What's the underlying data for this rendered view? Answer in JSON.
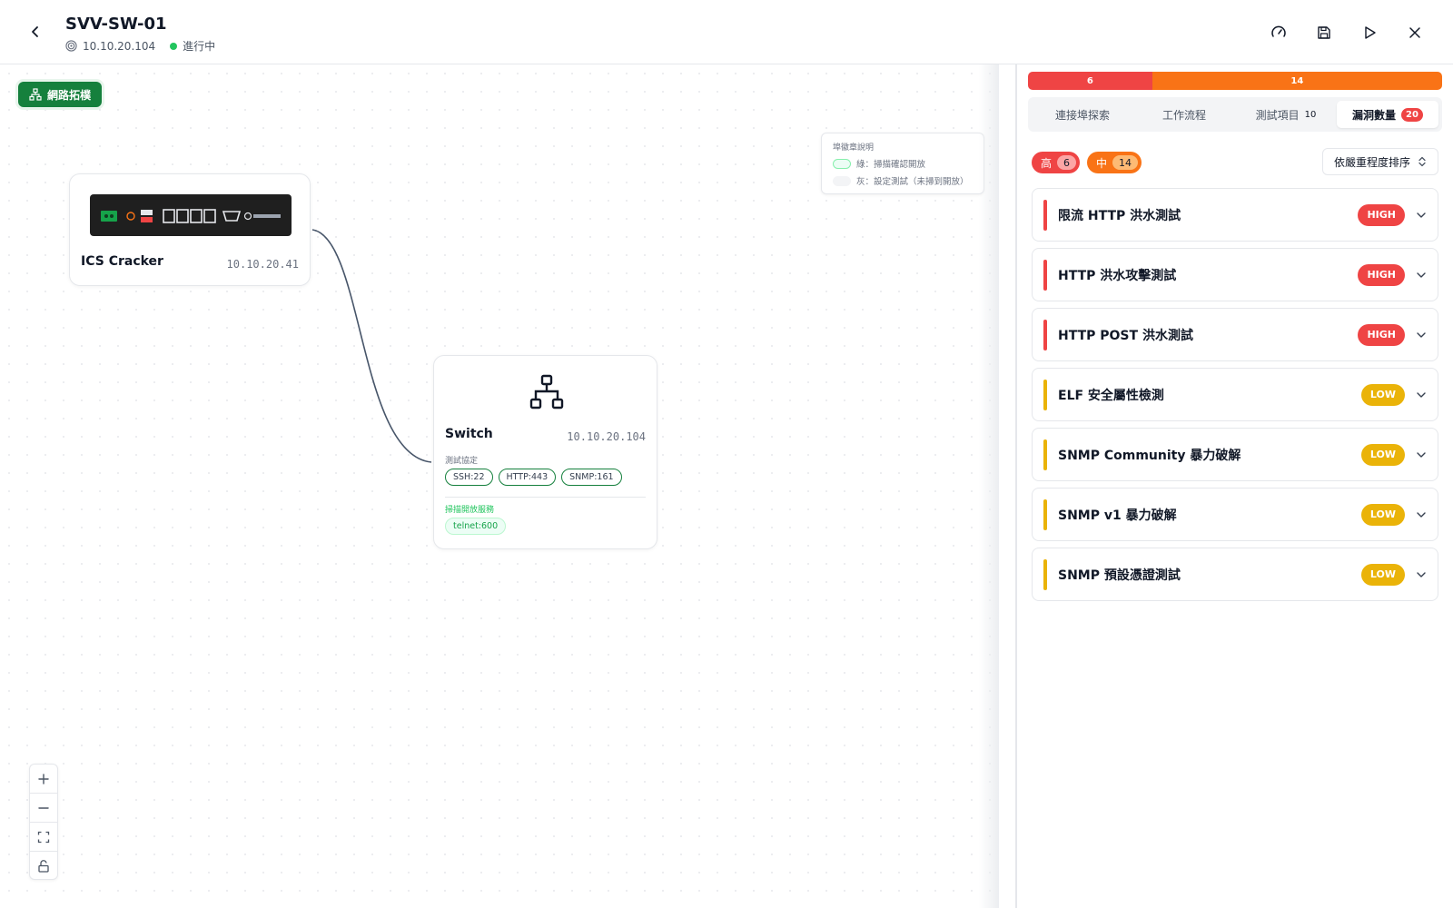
{
  "header": {
    "title": "SVV-SW-01",
    "ip": "10.10.20.104",
    "status": "進行中",
    "status_color": "#22c55e"
  },
  "canvas": {
    "topology_button": "網路拓樸",
    "legend": {
      "title": "埠徽章說明",
      "green_label": "綠：掃描確認開放",
      "gray_label": "灰：設定測試（未掃到開放）"
    },
    "nodes": {
      "cracker": {
        "name": "ICS Cracker",
        "ip": "10.10.20.41"
      },
      "switch": {
        "name": "Switch",
        "ip": "10.10.20.104",
        "test_protocols_label": "測試協定",
        "test_protocols": [
          "SSH:22",
          "HTTP:443",
          "SNMP:161"
        ],
        "open_services_label": "掃描開放服務",
        "open_services": [
          "telnet:600"
        ]
      }
    }
  },
  "panel": {
    "severity_bar": [
      {
        "label": "6",
        "value": 6,
        "color": "#ef4444"
      },
      {
        "label": "14",
        "value": 14,
        "color": "#f97316"
      }
    ],
    "tabs": [
      {
        "label": "連接埠探索"
      },
      {
        "label": "工作流程"
      },
      {
        "label": "測試項目",
        "count": "10"
      },
      {
        "label": "漏洞數量",
        "badge": "20",
        "active": true
      }
    ],
    "filters": {
      "high_label": "高",
      "high_count": "6",
      "mid_label": "中",
      "mid_count": "14"
    },
    "sort_label": "依嚴重程度排序",
    "vulnerabilities": [
      {
        "title": "限流 HTTP 洪水測試",
        "severity": "HIGH"
      },
      {
        "title": "HTTP 洪水攻擊測試",
        "severity": "HIGH"
      },
      {
        "title": "HTTP POST 洪水測試",
        "severity": "HIGH"
      },
      {
        "title": "ELF 安全屬性檢測",
        "severity": "LOW"
      },
      {
        "title": "SNMP Community 暴力破解",
        "severity": "LOW"
      },
      {
        "title": "SNMP v1 暴力破解",
        "severity": "LOW"
      },
      {
        "title": "SNMP 預設憑證測試",
        "severity": "LOW"
      }
    ],
    "severity_colors": {
      "HIGH": "#ef4444",
      "LOW": "#eab308"
    }
  }
}
